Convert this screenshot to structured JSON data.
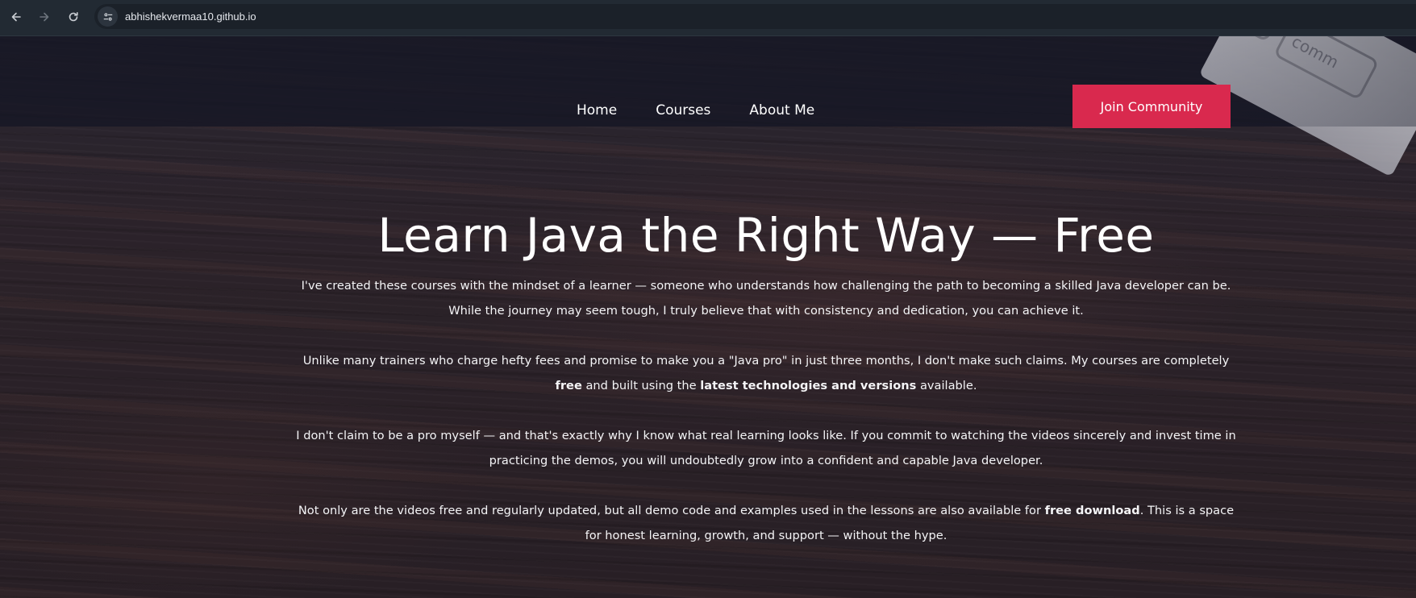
{
  "browser": {
    "url": "abhishekvermaa10.github.io",
    "icons": {
      "back": "back-arrow-icon",
      "forward": "forward-arrow-icon",
      "reload": "reload-icon",
      "site_info": "site-settings-icon"
    }
  },
  "site": {
    "nav": {
      "home": "Home",
      "courses": "Courses",
      "about": "About Me"
    },
    "join_button": "Join Community",
    "accent_color": "#d9294e"
  },
  "hero": {
    "title": "Learn Java the Right Way — Free",
    "p1": "I've created these courses with the mindset of a learner — someone who understands how challenging the path to becoming a skilled Java developer can be. While the journey may seem tough, I truly believe that with consistency and dedication, you can achieve it.",
    "p2_a": "Unlike many trainers who charge hefty fees and promise to make you a \"Java pro\" in just three months, I don't make such claims. My courses are completely ",
    "p2_b": "free",
    "p2_c": " and built using the ",
    "p2_d": "latest technologies and versions",
    "p2_e": " available.",
    "p3": "I don't claim to be a pro myself — and that's exactly why I know what real learning looks like. If you commit to watching the videos sincerely and invest time in practicing the demos, you will undoubtedly grow into a confident and capable Java developer.",
    "p4_a": "Not only are the videos free and regularly updated, but all demo code and examples used in the lessons are also available for ",
    "p4_b": "free download",
    "p4_c": ". This is a space for honest learning, growth, and support — without the hype."
  }
}
